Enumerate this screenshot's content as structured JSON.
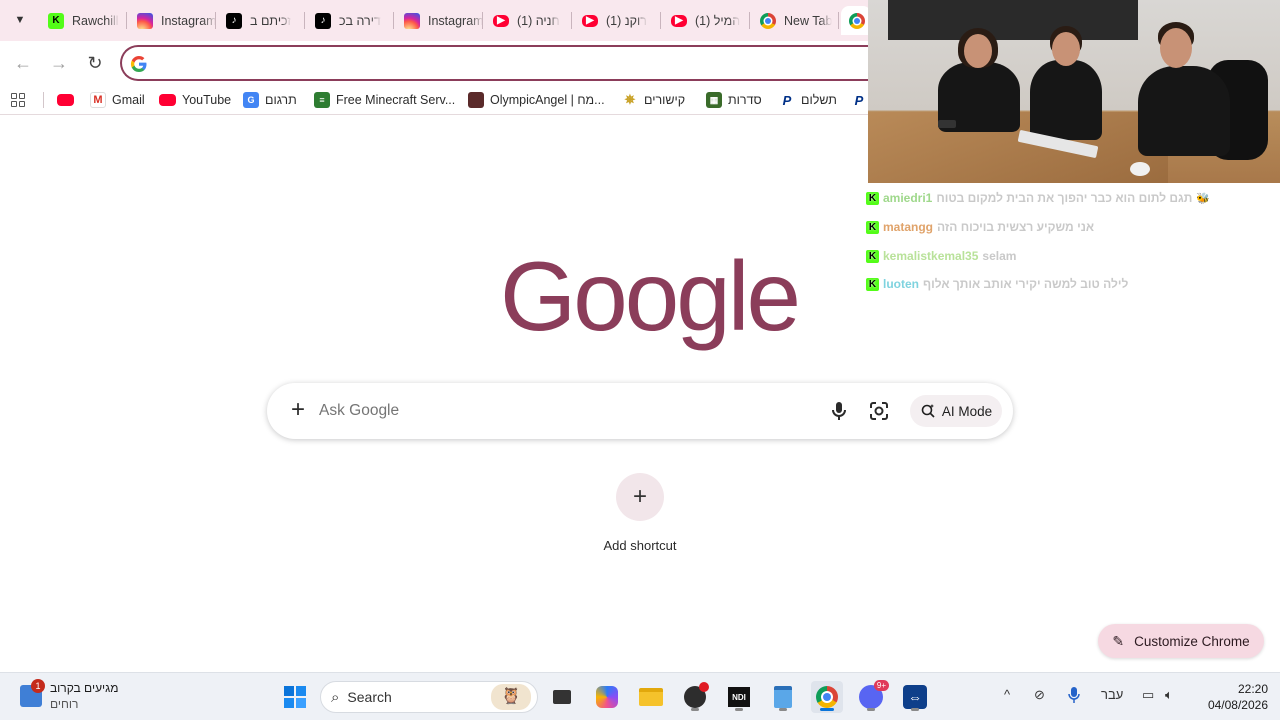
{
  "tabs": [
    {
      "label": "Rawchill",
      "icon": "kick-icon",
      "fav_text": "K"
    },
    {
      "label": "Instagram",
      "icon": "instagram-icon",
      "fav_text": ""
    },
    {
      "label": "זכיתם ב",
      "icon": "tiktok-icon",
      "fav_text": "♪"
    },
    {
      "label": "דירה בכ",
      "icon": "tiktok-icon",
      "fav_text": "♪"
    },
    {
      "label": "Instagram",
      "icon": "instagram-icon",
      "fav_text": ""
    },
    {
      "label": "(1) חניה",
      "icon": "youtube-icon",
      "fav_text": "▶"
    },
    {
      "label": "(1) רוקנ",
      "icon": "youtube-icon",
      "fav_text": "▶"
    },
    {
      "label": "(1) המיל",
      "icon": "youtube-icon",
      "fav_text": "▶"
    },
    {
      "label": "New Tab",
      "icon": "chrome-icon",
      "fav_text": ""
    },
    {
      "label": "",
      "icon": "chrome-icon",
      "fav_text": ""
    }
  ],
  "bookmarks": [
    {
      "label": "",
      "icon": "youtube-icon"
    },
    {
      "label": "Gmail",
      "icon": "gmail-icon"
    },
    {
      "label": "YouTube",
      "icon": "youtube-icon"
    },
    {
      "label": "תרגום",
      "icon": "translate-icon"
    },
    {
      "label": "Free Minecraft Serv...",
      "icon": "minecraft-icon"
    },
    {
      "label": "OlympicAngel | מח...",
      "icon": "profile-icon"
    },
    {
      "label": "קישורים",
      "icon": "star-icon"
    },
    {
      "label": "סדרות",
      "icon": "tv-icon"
    },
    {
      "label": "תשלום",
      "icon": "paypal-icon"
    },
    {
      "label": "",
      "icon": "paypal-icon"
    }
  ],
  "ntp": {
    "logo": "Google",
    "search_placeholder": "Ask Google",
    "ai_mode": "AI Mode",
    "add_shortcut": "Add shortcut",
    "customize": "Customize Chrome"
  },
  "chat": [
    {
      "user": "amiedri1",
      "user_color": "#9fd88b",
      "message": "תגם לתום הוא כבר יהפוך את הבית למקום בטוח",
      "extra": "🐝"
    },
    {
      "user": "matangg",
      "user_color": "#e0a36a",
      "message": "אני משקיע רצשית בויכוח הזה",
      "extra": ""
    },
    {
      "user": "kemalistkemal35",
      "user_color": "#b9e29a",
      "message": "selam",
      "extra": ""
    },
    {
      "user": "luoten",
      "user_color": "#7fd3df",
      "message": "לילה טוב למשה יקירי אותב אותך אלוף",
      "extra": ""
    }
  ],
  "taskbar": {
    "weather_badge": "1",
    "weather_title": "מגיעים בקרוב",
    "weather_sub": "רוחים",
    "search": "Search",
    "language": "עבר",
    "time": "22:20",
    "date": "04/08/2026",
    "discord_badge": "9+"
  },
  "colors": {
    "accent": "#8b3d5a",
    "tabstrip": "#f9e8ee",
    "customize_bg": "#f6d9e2"
  }
}
